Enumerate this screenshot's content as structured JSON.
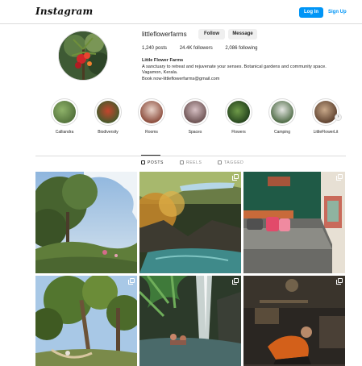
{
  "header": {
    "logo_text": "Instagram",
    "login_label": "Log In",
    "signup_label": "Sign Up"
  },
  "profile": {
    "username": "littleflowerfarms",
    "follow_label": "Follow",
    "message_label": "Message",
    "posts": "1,240 posts",
    "followers": "24.4K followers",
    "following": "2,086 following",
    "display_name": "Little Flower Farms",
    "bio_line1": "A sanctuary to retreat and rejuvenate your senses. Botanical gardens and community space.",
    "bio_line2": "Vagamon, Kerala.",
    "bio_line3": "Book now-littleflowerfarms@gmail.com"
  },
  "highlights": [
    {
      "label": "Calliandra"
    },
    {
      "label": "Biodiversity"
    },
    {
      "label": "Rooms"
    },
    {
      "label": "Spaces"
    },
    {
      "label": "Flowers"
    },
    {
      "label": "Camping"
    },
    {
      "label": "LittleFlowerLit"
    }
  ],
  "tabs": {
    "posts": "POSTS",
    "reels": "REELS",
    "tagged": "TAGGED"
  },
  "colors": {
    "accent": "#0095f6",
    "text": "#262626",
    "muted": "#8e8e8e",
    "border": "#dbdbdb"
  }
}
